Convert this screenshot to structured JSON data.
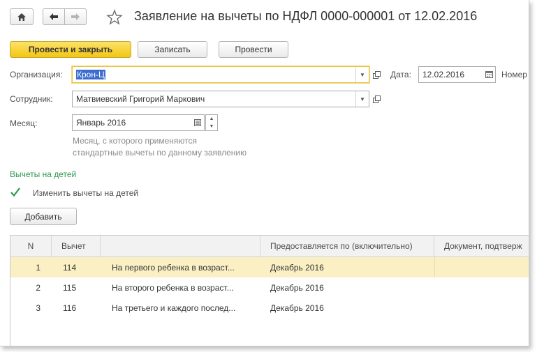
{
  "window": {
    "title": "Заявление на вычеты по НДФЛ 0000-000001 от 12.02.2016"
  },
  "toolbar": {
    "post_close_label": "Провести и закрыть",
    "save_label": "Записать",
    "post_label": "Провести"
  },
  "form": {
    "organization": {
      "label": "Организация:",
      "value": "Крон-Ц"
    },
    "date": {
      "label": "Дата:",
      "value": "12.02.2016"
    },
    "number": {
      "label": "Номер"
    },
    "employee": {
      "label": "Сотрудник:",
      "value": "Матвиевский Григорий Маркович"
    },
    "month": {
      "label": "Месяц:",
      "value": "Январь 2016",
      "hint_line1": "Месяц, с которого применяются",
      "hint_line2": "стандартные вычеты по данному заявлению"
    }
  },
  "children_section": {
    "title": "Вычеты на детей",
    "checkbox_label": "Изменить вычеты на детей",
    "checked": true,
    "add_label": "Добавить"
  },
  "table": {
    "columns": [
      "N",
      "Вычет",
      "",
      "Предоставляется по (включительно)",
      "Документ, подтверж"
    ],
    "rows": [
      {
        "n": "1",
        "code": "114",
        "desc": "На первого ребенка в возраст...",
        "until": "Декабрь 2016",
        "doc": ""
      },
      {
        "n": "2",
        "code": "115",
        "desc": "На второго ребенка в возраст...",
        "until": "Декабрь 2016",
        "doc": ""
      },
      {
        "n": "3",
        "code": "116",
        "desc": "На третьего и каждого послед...",
        "until": "Декабрь 2016",
        "doc": ""
      }
    ]
  },
  "colors": {
    "primary_button": "#f3c613",
    "focus_border": "#e8c34a",
    "selected_row": "#fbf0c4",
    "group_title": "#2e9a4f",
    "text_selection": "#3b6ad0"
  }
}
